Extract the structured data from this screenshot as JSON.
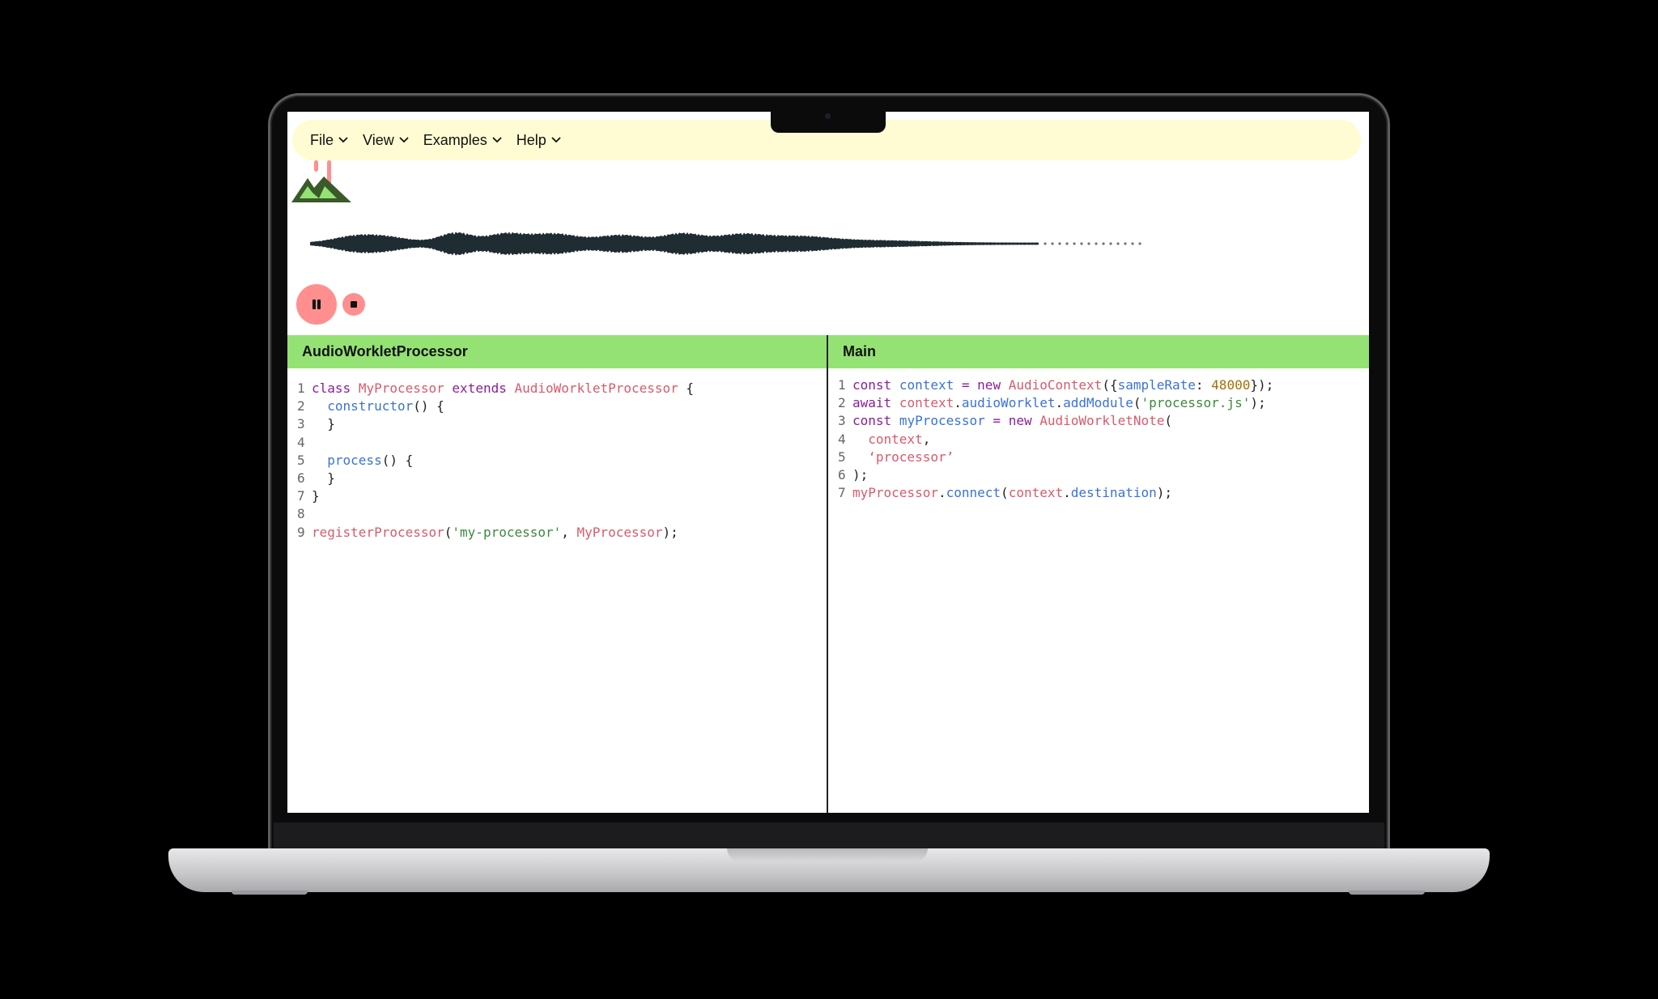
{
  "menu": [
    {
      "label": "File"
    },
    {
      "label": "View"
    },
    {
      "label": "Examples"
    },
    {
      "label": "Help"
    }
  ],
  "player": {
    "pause_icon": "pause-icon",
    "stop_icon": "stop-icon"
  },
  "left_panel": {
    "title": "AudioWorkletProcessor",
    "lines": [
      [
        [
          "kw",
          "class"
        ],
        [
          "t",
          " "
        ],
        [
          "cls",
          "MyProcessor"
        ],
        [
          "t",
          " "
        ],
        [
          "kw",
          "extends"
        ],
        [
          "t",
          " "
        ],
        [
          "cls",
          "AudioWorkletProcessor"
        ],
        [
          "t",
          " {"
        ]
      ],
      [
        [
          "t",
          "  "
        ],
        [
          "fn",
          "constructor"
        ],
        [
          "t",
          "() {"
        ]
      ],
      [
        [
          "t",
          "  }"
        ]
      ],
      [
        [
          "t",
          ""
        ]
      ],
      [
        [
          "t",
          "  "
        ],
        [
          "fn",
          "process"
        ],
        [
          "t",
          "() {"
        ]
      ],
      [
        [
          "t",
          "  }"
        ]
      ],
      [
        [
          "t",
          "}"
        ]
      ],
      [
        [
          "t",
          ""
        ]
      ],
      [
        [
          "var",
          "registerProcessor"
        ],
        [
          "t",
          "("
        ],
        [
          "str",
          "'my-processor'"
        ],
        [
          "t",
          ", "
        ],
        [
          "cls",
          "MyProcessor"
        ],
        [
          "t",
          ");"
        ]
      ]
    ]
  },
  "right_panel": {
    "title": "Main",
    "lines": [
      [
        [
          "kw",
          "const"
        ],
        [
          "t",
          " "
        ],
        [
          "prop",
          "context"
        ],
        [
          "t",
          " "
        ],
        [
          "op",
          "="
        ],
        [
          "t",
          " "
        ],
        [
          "kw",
          "new"
        ],
        [
          "t",
          " "
        ],
        [
          "cls",
          "AudioContext"
        ],
        [
          "t",
          "({"
        ],
        [
          "prop",
          "sampleRate"
        ],
        [
          "t",
          ": "
        ],
        [
          "num",
          "48000"
        ],
        [
          "t",
          "});"
        ]
      ],
      [
        [
          "kw",
          "await"
        ],
        [
          "t",
          " "
        ],
        [
          "var",
          "context"
        ],
        [
          "t",
          "."
        ],
        [
          "prop",
          "audioWorklet"
        ],
        [
          "t",
          "."
        ],
        [
          "fn",
          "addModule"
        ],
        [
          "t",
          "("
        ],
        [
          "str",
          "'processor.js'"
        ],
        [
          "t",
          ");"
        ]
      ],
      [
        [
          "kw",
          "const"
        ],
        [
          "t",
          " "
        ],
        [
          "prop",
          "myProcessor"
        ],
        [
          "t",
          " "
        ],
        [
          "op",
          "="
        ],
        [
          "t",
          " "
        ],
        [
          "kw",
          "new"
        ],
        [
          "t",
          " "
        ],
        [
          "cls",
          "AudioWorkletNote"
        ],
        [
          "t",
          "("
        ]
      ],
      [
        [
          "t",
          "  "
        ],
        [
          "var",
          "context"
        ],
        [
          "t",
          ","
        ]
      ],
      [
        [
          "t",
          "  "
        ],
        [
          "var",
          "‘processor’"
        ]
      ],
      [
        [
          "t",
          ");"
        ]
      ],
      [
        [
          "var",
          "myProcessor"
        ],
        [
          "t",
          "."
        ],
        [
          "fn",
          "connect"
        ],
        [
          "t",
          "("
        ],
        [
          "var",
          "context"
        ],
        [
          "t",
          "."
        ],
        [
          "prop",
          "destination"
        ],
        [
          "t",
          ");"
        ]
      ]
    ]
  },
  "colors": {
    "menubar": "#fffcd3",
    "panel_header": "#95e274",
    "play_button": "#ff8f8f",
    "waveform": "#1f2d33"
  }
}
